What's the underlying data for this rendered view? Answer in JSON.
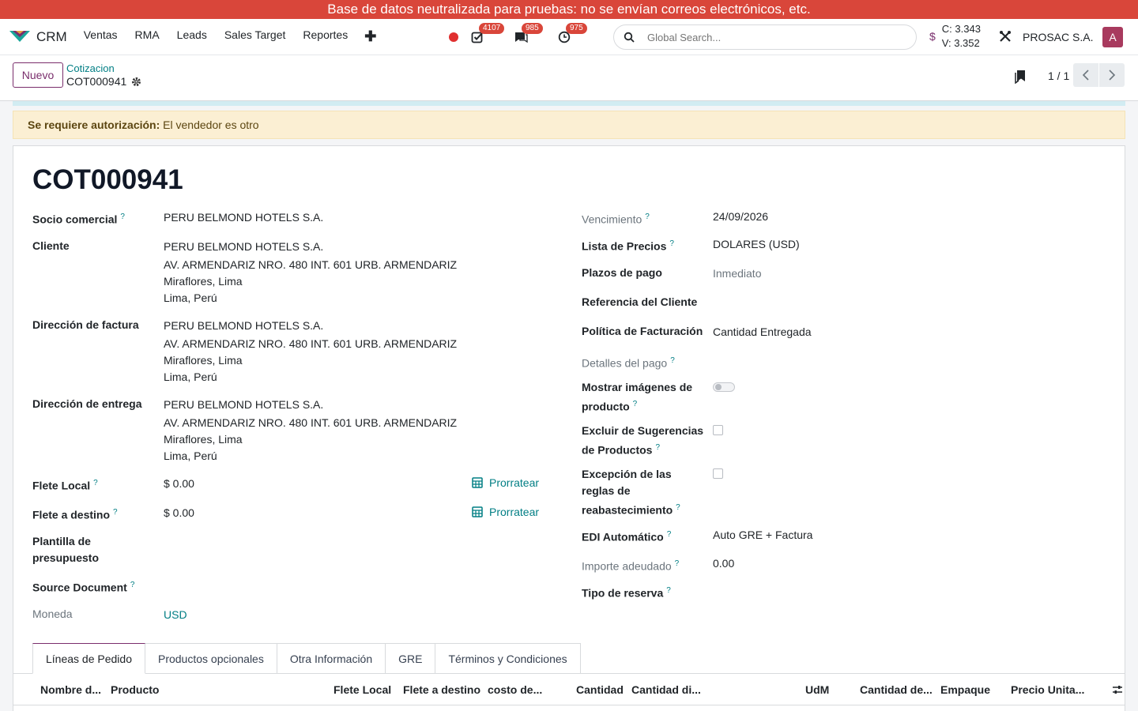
{
  "banner": "Base de datos neutralizada para pruebas: no se envían correos electrónicos, etc.",
  "nav": {
    "app_name": "CRM",
    "menu": [
      "Ventas",
      "RMA",
      "Leads",
      "Sales Target",
      "Reportes"
    ],
    "plus": "✚",
    "badges": {
      "activities": "4107",
      "messages": "985",
      "clock": "975"
    },
    "search_placeholder": "Global Search...",
    "rates": {
      "c": "C: 3.343",
      "v": "V: 3.352",
      "symbol": "$"
    },
    "company": "PROSAC S.A.",
    "avatar_letter": "A",
    "icons": [
      "crm-logo-icon",
      "record-dot-icon",
      "check-square-icon",
      "chat-icon",
      "clock-icon",
      "search-icon",
      "tools-icon"
    ]
  },
  "control": {
    "new_button": "Nuevo",
    "breadcrumb_parent": "Cotizacion",
    "breadcrumb_current": "COT000941",
    "pager": "1 / 1"
  },
  "alert": {
    "title": "Se requiere autorización:",
    "message": "El vendedor es otro"
  },
  "form": {
    "title": "COT000941",
    "left": {
      "socio_label": "Socio comercial",
      "socio_value": "PERU BELMOND HOTELS S.A.",
      "cliente_label": "Cliente",
      "cliente": [
        "PERU BELMOND HOTELS S.A.",
        "AV. ARMENDARIZ NRO. 480 INT. 601 URB. ARMENDARIZ",
        "Miraflores, Lima",
        "Lima, Perú"
      ],
      "factura_label": "Dirección de factura",
      "factura": [
        "PERU BELMOND HOTELS S.A.",
        "AV. ARMENDARIZ NRO. 480 INT. 601 URB. ARMENDARIZ",
        "Miraflores, Lima",
        "Lima, Perú"
      ],
      "entrega_label": "Dirección de entrega",
      "entrega": [
        "PERU BELMOND HOTELS S.A.",
        "AV. ARMENDARIZ NRO. 480 INT. 601 URB. ARMENDARIZ",
        "Miraflores, Lima",
        "Lima, Perú"
      ],
      "flete_local_label": "Flete Local",
      "flete_local_value": "$ 0.00",
      "flete_destino_label": "Flete a destino",
      "flete_destino_value": "$ 0.00",
      "prorratear": "Prorratear",
      "plantilla_label_1": "Plantilla de",
      "plantilla_label_2": "presupuesto",
      "source_label": "Source Document",
      "moneda_label": "Moneda",
      "moneda_value": "USD"
    },
    "right": {
      "vencimiento_label": "Vencimiento",
      "vencimiento_value": "24/09/2026",
      "lista_label": "Lista de Precios",
      "lista_value": "DOLARES (USD)",
      "plazos_label": "Plazos de pago",
      "plazos_value": "Inmediato",
      "referencia_label": "Referencia del Cliente",
      "politica_label": "Política de Facturación",
      "politica_value": "Cantidad Entregada",
      "detalles_label": "Detalles del pago",
      "mostrar_label_1": "Mostrar imágenes de",
      "mostrar_label_2": "producto",
      "excluir_label_1": "Excluir de Sugerencias",
      "excluir_label_2": "de Productos",
      "excepcion_label_1": "Excepción de las",
      "excepcion_label_2": "reglas de",
      "excepcion_label_3": "reabastecimiento",
      "edi_label": "EDI Automático",
      "edi_value": "Auto GRE + Factura",
      "importe_label": "Importe adeudado",
      "importe_value": "0.00",
      "tipo_label": "Tipo de reserva",
      "mostrar_imagenes_enabled": false,
      "excluir_sugerencias_checked": false,
      "excepcion_reglas_checked": false
    },
    "help_mark": "?"
  },
  "tabs": [
    "Líneas de Pedido",
    "Productos opcionales",
    "Otra Información",
    "GRE",
    "Términos y Condiciones"
  ],
  "table_headers": [
    "Nombre d...",
    "Producto",
    "Flete Local",
    "Flete a destino",
    "costo de...",
    "Cantidad",
    "Cantidad di...",
    "UdM",
    "Cantidad de...",
    "Empaque",
    "Precio Unita..."
  ],
  "colors": {
    "brand": "#7a2e6c",
    "teal": "#017e84",
    "banner": "#d9463a",
    "alert_bg": "#fbefd3"
  }
}
